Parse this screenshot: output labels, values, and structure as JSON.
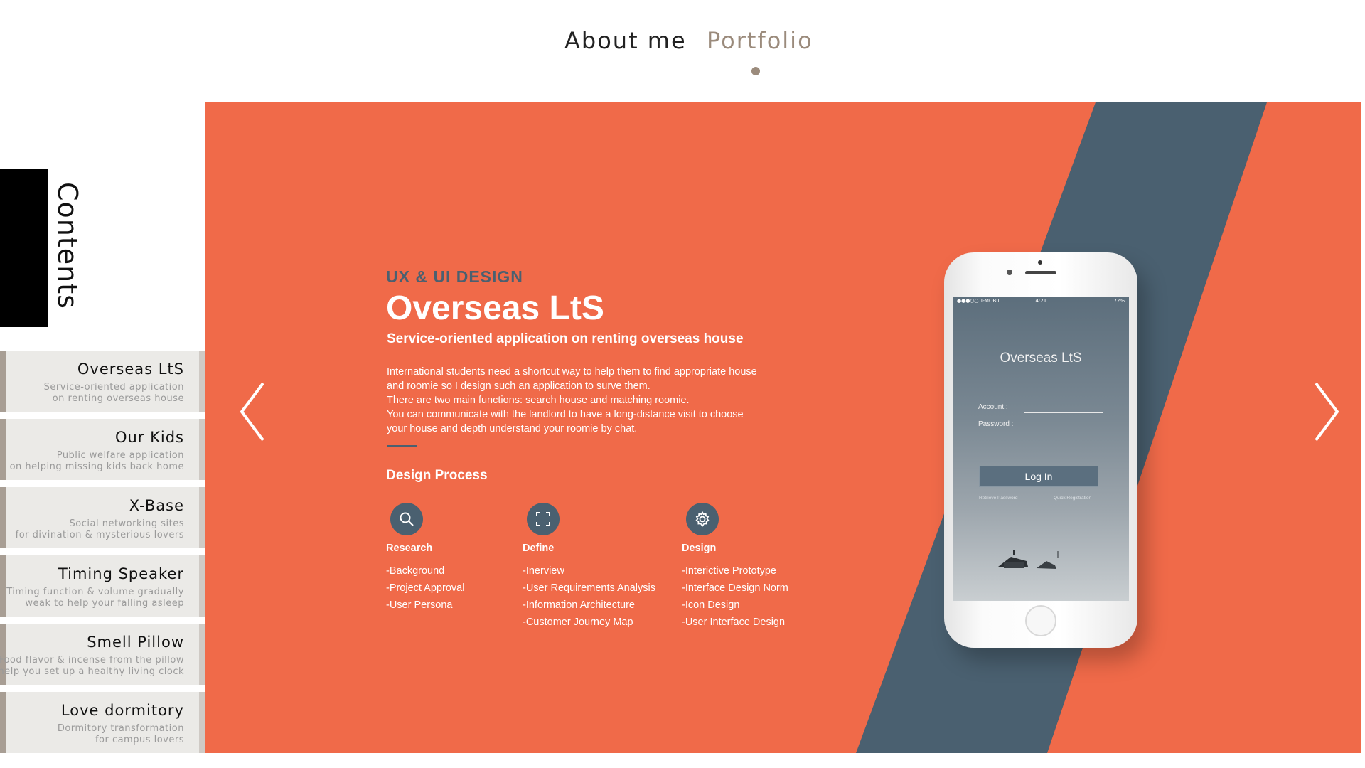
{
  "nav": {
    "about": "About me",
    "portfolio": "Portfolio"
  },
  "sidebar": {
    "heading": "Contents",
    "items": [
      {
        "title": "Overseas LtS",
        "sub1": "Service-oriented application",
        "sub2": "on renting overseas house"
      },
      {
        "title": "Our Kids",
        "sub1": "Public welfare application",
        "sub2": "on helping missing kids back home"
      },
      {
        "title": "X-Base",
        "sub1": "Social networking sites",
        "sub2": "for divination & mysterious lovers"
      },
      {
        "title": "Timing Speaker",
        "sub1": "Timing function & volume gradually",
        "sub2": "weak to help your falling asleep"
      },
      {
        "title": "Smell Pillow",
        "sub1": "Food flavor & incense from the pillow",
        "sub2": "help you set up a healthy living clock"
      },
      {
        "title": "Love dormitory",
        "sub1": "Dormitory transformation",
        "sub2": "for campus lovers"
      }
    ]
  },
  "project": {
    "kicker": "UX & UI DESIGN",
    "title": "Overseas LtS",
    "subtitle": "Service-oriented application on renting overseas house",
    "description": [
      "International students need a shortcut way to help them to find appropriate house",
      "and roomie so I design such an application to surve them.",
      "There are two main functions: search house and matching roomie.",
      "You can communicate with the landlord to have a long-distance visit to choose",
      "your house and depth understand your roomie by chat."
    ],
    "process_title": "Design Process",
    "process": [
      {
        "name": "Research",
        "icon": "search-icon",
        "items": [
          "-Background",
          "-Project Approval",
          "-User Persona"
        ]
      },
      {
        "name": "Define",
        "icon": "focus-frame-icon",
        "items": [
          "-Inerview",
          "-User Requirements Analysis",
          "-Information Architecture",
          "-Customer Journey Map"
        ]
      },
      {
        "name": "Design",
        "icon": "gear-icon",
        "items": [
          "-Interictive Prototype",
          "-Interface Design Norm",
          "-Icon Design",
          "-User Interface Design"
        ]
      }
    ]
  },
  "phone_screen": {
    "status_carrier": "●●●○○ T-MOBIL",
    "status_time": "14:21",
    "status_battery": "72%",
    "app_title": "Overseas LtS",
    "account_label": "Account :",
    "password_label": "Password :",
    "login_label": "Log In",
    "retrieve_label": "Retrieve Password",
    "quick_label": "Quick Registration"
  },
  "colors": {
    "accent": "#f06a49",
    "stripe": "#4a6070",
    "nav_active": "#9b8b7c"
  }
}
